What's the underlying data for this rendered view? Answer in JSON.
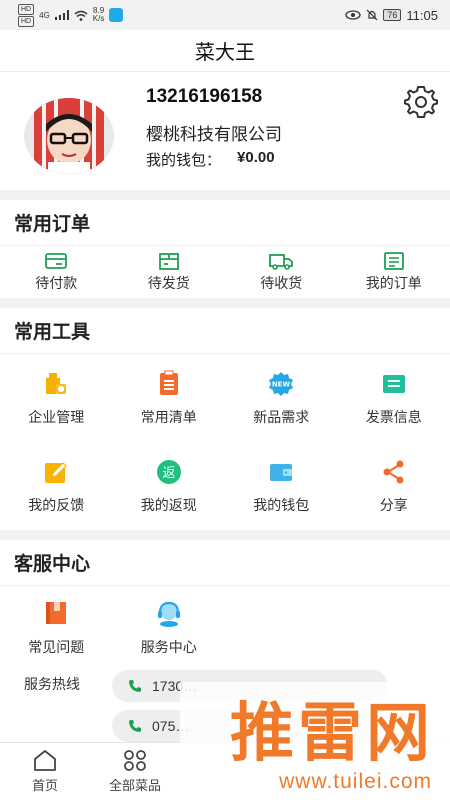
{
  "statusbar": {
    "left_chips": [
      "HD",
      "HD"
    ],
    "network": "4G",
    "speed": "8.9",
    "speed_unit": "K/s",
    "battery": "76",
    "time": "11:05"
  },
  "app": {
    "title": "菜大王"
  },
  "profile": {
    "phone": "13216196158",
    "company": "樱桃科技有限公司",
    "wallet_label": "我的钱包：",
    "wallet_amount": "¥0.00"
  },
  "orders": {
    "title": "常用订单",
    "items": [
      {
        "label": "待付款",
        "icon": "card-icon"
      },
      {
        "label": "待发货",
        "icon": "box-icon"
      },
      {
        "label": "待收货",
        "icon": "truck-icon"
      },
      {
        "label": "我的订单",
        "icon": "receipt-icon"
      }
    ]
  },
  "tools": {
    "title": "常用工具",
    "items": [
      {
        "label": "企业管理",
        "icon": "building-icon",
        "color": "#f6b100"
      },
      {
        "label": "常用清单",
        "icon": "clipboard-icon",
        "color": "#f26b2c"
      },
      {
        "label": "新品需求",
        "icon": "new-badge-icon",
        "color": "#23a7e6"
      },
      {
        "label": "发票信息",
        "icon": "invoice-icon",
        "color": "#1fbf9c"
      },
      {
        "label": "我的反馈",
        "icon": "edit-icon",
        "color": "#f6b400"
      },
      {
        "label": "我的返现",
        "icon": "cashback-icon",
        "color": "#1fbf7e"
      },
      {
        "label": "我的钱包",
        "icon": "wallet-icon",
        "color": "#3fb3e9"
      },
      {
        "label": "分享",
        "icon": "share-icon",
        "color": "#f26b2c"
      }
    ]
  },
  "service": {
    "title": "客服中心",
    "items": [
      {
        "label": "常见问题",
        "icon": "book-icon",
        "color": "#f26b2c"
      },
      {
        "label": "服务中心",
        "icon": "headset-icon",
        "color": "#23a7e6"
      }
    ],
    "hotline_label": "服务热线",
    "hotlines": [
      "1730…",
      "075…"
    ]
  },
  "tabbar": {
    "items": [
      {
        "label": "首页",
        "icon": "home-icon"
      },
      {
        "label": "全部菜品",
        "icon": "grid-icon"
      }
    ]
  },
  "watermark": {
    "text": "推雷网",
    "url": "www.tuilei.com"
  },
  "colors": {
    "accent": "#1fa050",
    "watermark": "#f07a2a"
  }
}
